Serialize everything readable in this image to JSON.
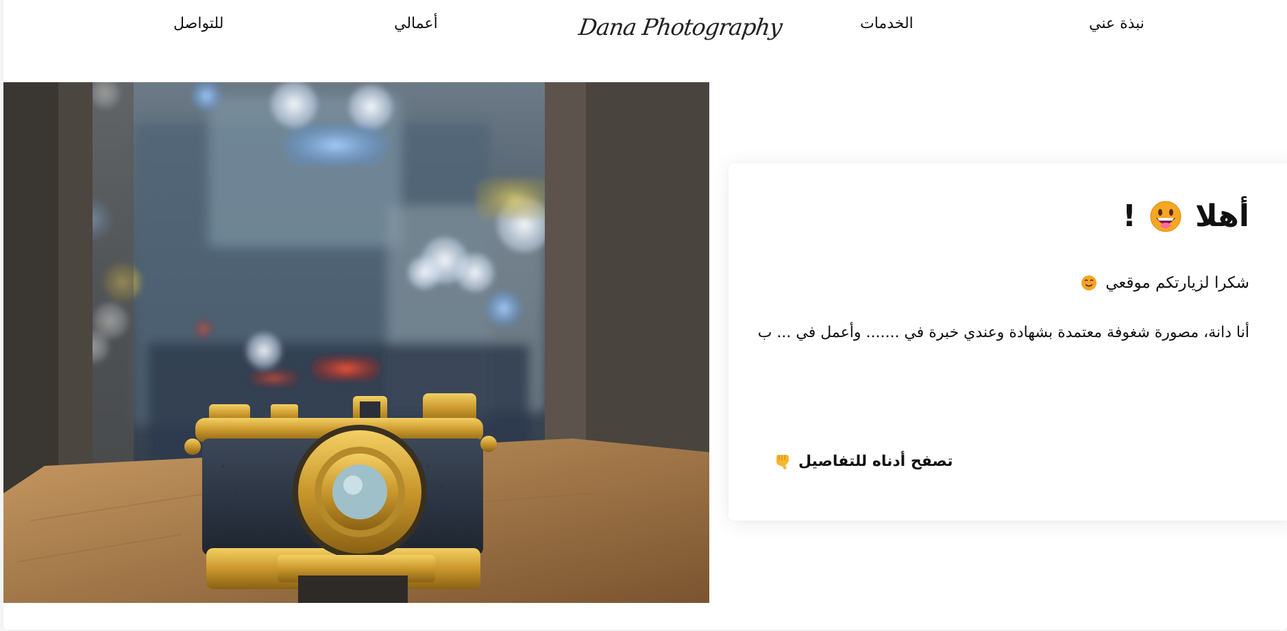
{
  "nav": {
    "contact": "للتواصل",
    "works": "أعمالي",
    "logo": "Dana Photography",
    "services": "الخدمات",
    "about": "نبذة عني"
  },
  "hero": {
    "image_description_icon": "camera-photo"
  },
  "card": {
    "title": "أهلا",
    "title_suffix": "!",
    "title_emoji": "grinning-face-icon",
    "subtitle": "شكرا لزيارتكم موقعي",
    "subtitle_emoji": "smiling-face-icon",
    "body": "أنا دانة، مصورة شغوفة معتمدة بشهادة وعندي خبرة في ....... وأعمل في ... ب",
    "browse": "تصفح أدناه للتفاصيل",
    "browse_emoji": "pointing-down-hand-icon"
  },
  "colors": {
    "text": "#111111",
    "emoji_yellow": "#f5a623",
    "background": "#ffffff"
  }
}
